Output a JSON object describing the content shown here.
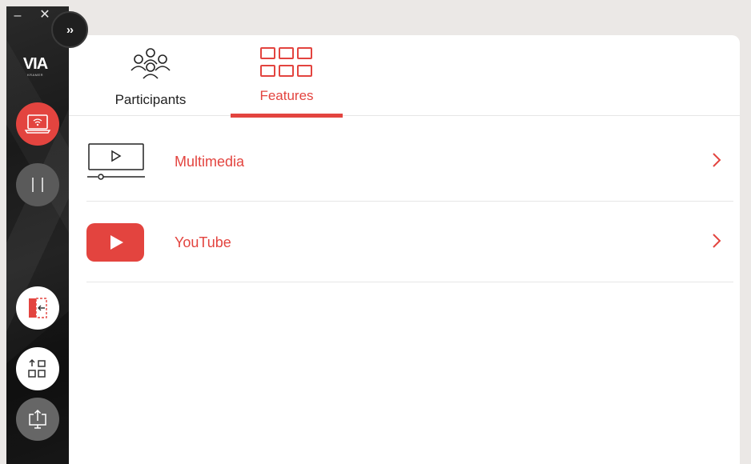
{
  "window": {
    "minimize_glyph": "–",
    "close_glyph": "✕"
  },
  "sidebar": {
    "logo_text": "VIA",
    "logo_subtext": "KRAMER",
    "expand_glyph": "››",
    "buttons": [
      {
        "name": "cast",
        "icon": "laptop-wifi-icon"
      },
      {
        "name": "pause",
        "icon": "pause-icon"
      },
      {
        "name": "exit",
        "icon": "exit-door-icon"
      },
      {
        "name": "layout",
        "icon": "layout-upload-icon"
      },
      {
        "name": "share",
        "icon": "monitor-share-icon"
      }
    ]
  },
  "tabs": [
    {
      "label": "Participants",
      "icon": "people-group-icon",
      "active": false
    },
    {
      "label": "Features",
      "icon": "grid-icon",
      "active": true
    }
  ],
  "features": [
    {
      "label": "Multimedia",
      "icon": "video-player-icon"
    },
    {
      "label": "YouTube",
      "icon": "youtube-icon"
    }
  ],
  "colors": {
    "accent": "#e3443f",
    "sidebar_bg": "#1e1e1e",
    "panel_bg": "#ffffff",
    "background": "#ebe8e6",
    "divider": "#e6e6e6"
  }
}
